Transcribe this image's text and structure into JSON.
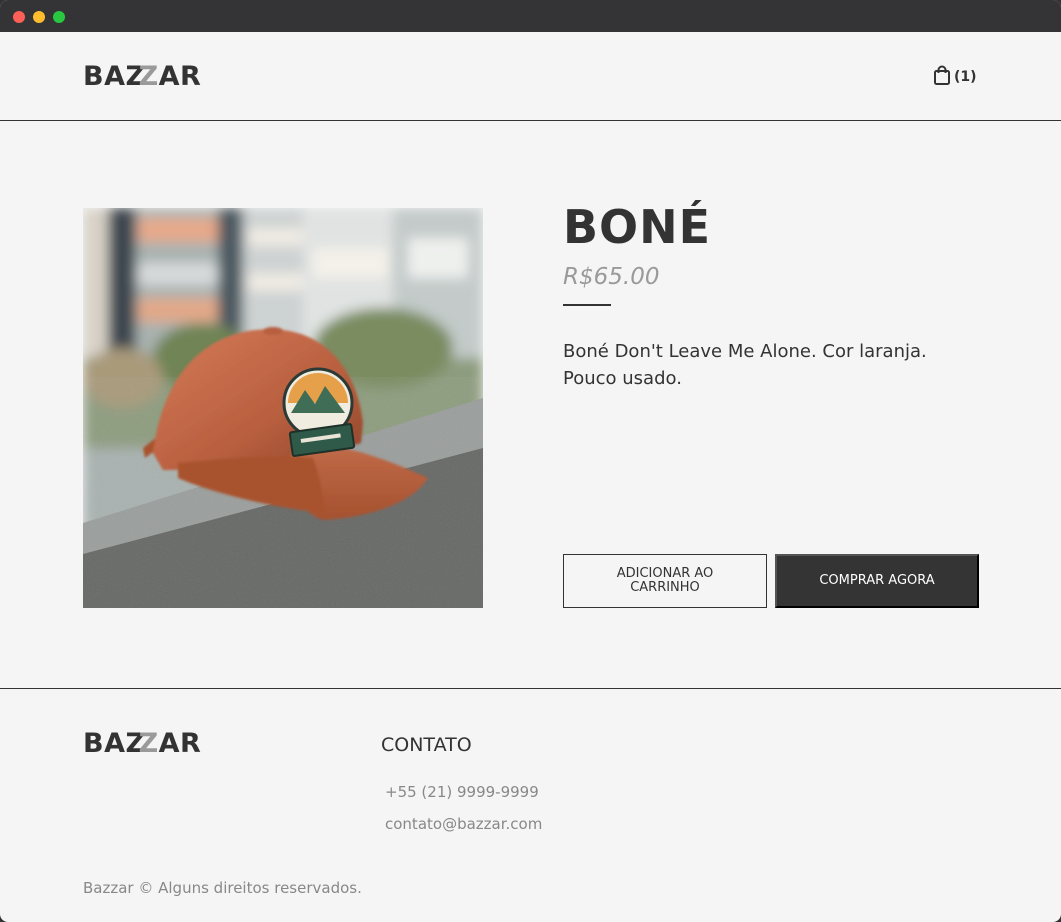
{
  "header": {
    "logo": {
      "part1": "BAZ",
      "part2": "Z",
      "part3": "AR"
    },
    "cart": {
      "icon": "shopping-bag-icon",
      "count": "(1)"
    }
  },
  "product": {
    "image": "photo of an orange cap on a ledge",
    "title": "BONÉ",
    "price": "R$65.00",
    "description": "Boné Don't Leave Me Alone. Cor laranja. Pouco usado.",
    "add_to_cart_label": "ADICIONAR AO CARRINHO",
    "buy_now_label": "COMPRAR AGORA"
  },
  "footer": {
    "logo": {
      "part1": "BAZ",
      "part2": "Z",
      "part3": "AR"
    },
    "contact_title": "CONTATO",
    "phone": "+55 (21) 9999-9999",
    "email": "contato@bazzar.com",
    "copyright": "Bazzar © Alguns direitos reservados."
  },
  "colors": {
    "background": "#f5f5f5",
    "text": "#333333",
    "muted": "#9a9a9a",
    "button_dark": "#343434"
  }
}
